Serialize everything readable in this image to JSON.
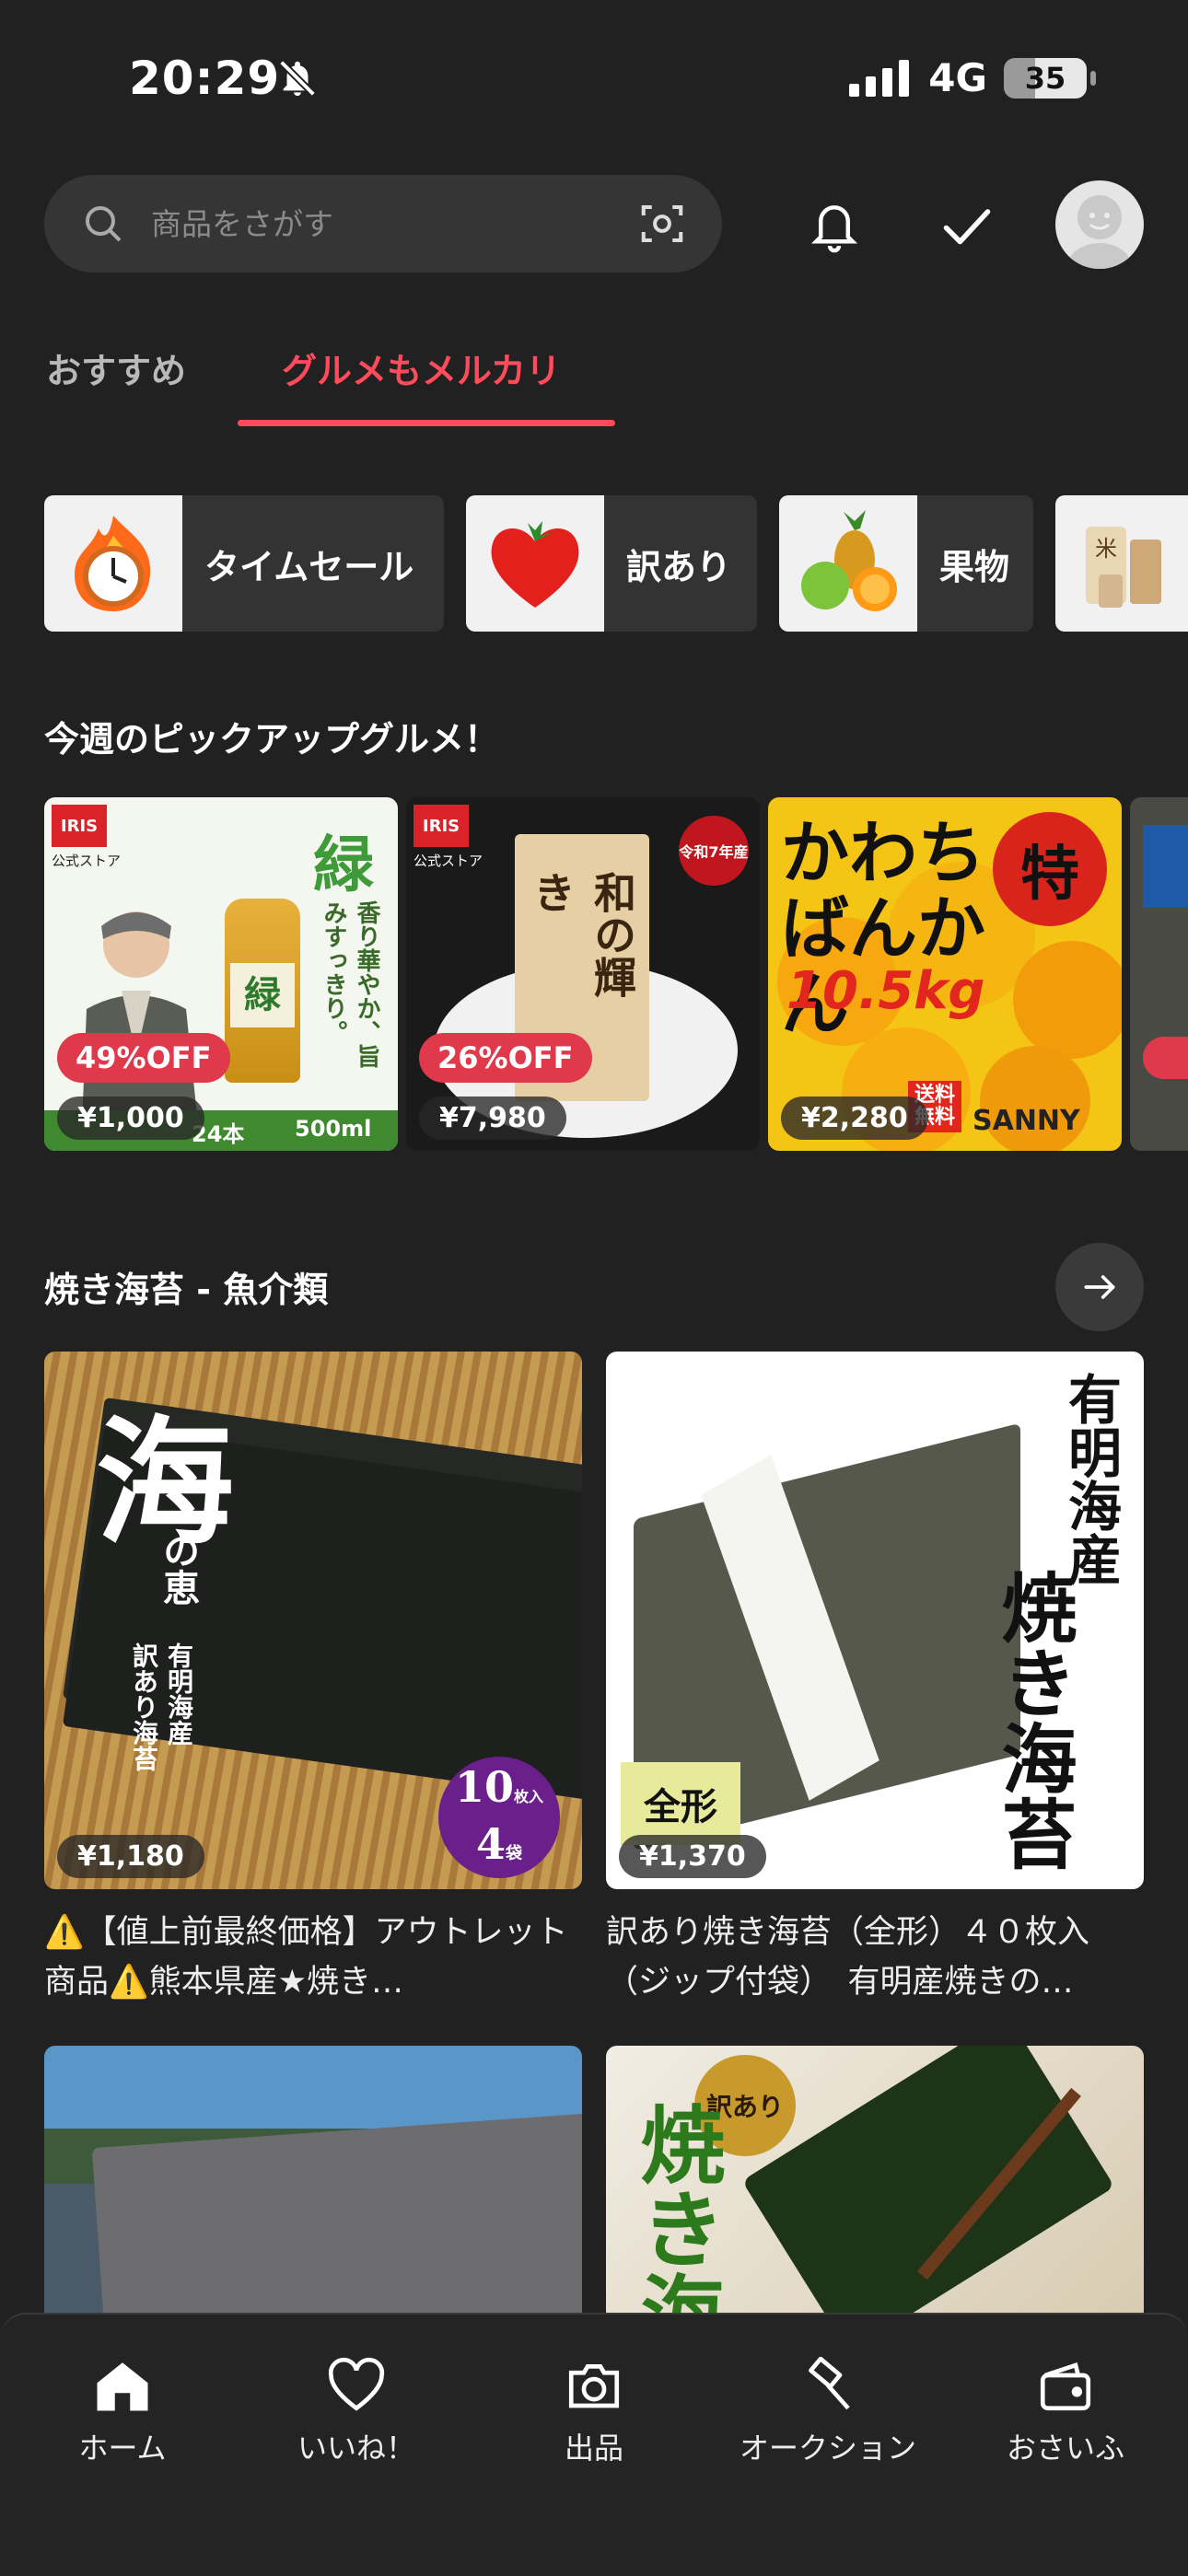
{
  "status": {
    "time": "20:29",
    "network": "4G",
    "battery": "35"
  },
  "search": {
    "placeholder": "商品をさがす"
  },
  "tabs": [
    {
      "label": "おすすめ",
      "active": false
    },
    {
      "label": "グルメもメルカリ",
      "active": true
    }
  ],
  "categories": [
    {
      "label": "タイムセール",
      "icon": "clock-fire-icon"
    },
    {
      "label": "訳あり",
      "icon": "tomato-heart-icon"
    },
    {
      "label": "果物",
      "icon": "fruit-icon"
    },
    {
      "label": "",
      "icon": "rice-bag-icon"
    }
  ],
  "pickup": {
    "title": "今週のピックアップグルメ！",
    "items": [
      {
        "discount": "49%OFF",
        "price": "¥1,000",
        "badge": "IRIS",
        "store": "公式ストア",
        "big": "緑",
        "copy": "香り華やか、旨みすっきり。",
        "bottom1": "24本",
        "bottom2": "500ml"
      },
      {
        "discount": "26%OFF",
        "price": "¥7,980",
        "badge": "IRIS",
        "store": "公式ストア",
        "big": "和の輝き",
        "year": "令和7年産"
      },
      {
        "price": "¥2,280",
        "big": "かわちばんかん",
        "weight": "10.5kg",
        "special": "特",
        "free": "送料無料",
        "shop": "SANNY"
      }
    ]
  },
  "nori": {
    "title": "焼き海苔 - 魚介類",
    "items": [
      {
        "price": "¥1,180",
        "big": "海",
        "sub": "の恵",
        "vert1": "有明海産",
        "vert2": "訳あり海苔",
        "count1": "10",
        "count1u": "枚入",
        "count2": "4",
        "count2u": "袋",
        "title": "⚠️【値上前最終価格】アウトレット商品⚠️熊本県産★焼き…"
      },
      {
        "price": "¥1,370",
        "vert1": "有明海産",
        "vert2": "焼き海苔",
        "tag": "全形",
        "title": "訳あり焼き海苔（全形）４０枚入（ジップ付袋）　有明産焼きの…"
      },
      {
        "price": ""
      },
      {
        "price": "",
        "tag": "訳あり",
        "big": "焼き海"
      }
    ]
  },
  "nav": [
    {
      "label": "ホーム",
      "icon": "home-icon"
    },
    {
      "label": "いいね！",
      "icon": "heart-icon"
    },
    {
      "label": "出品",
      "icon": "camera-icon"
    },
    {
      "label": "オークション",
      "icon": "gavel-icon"
    },
    {
      "label": "おさいふ",
      "icon": "wallet-icon"
    }
  ]
}
